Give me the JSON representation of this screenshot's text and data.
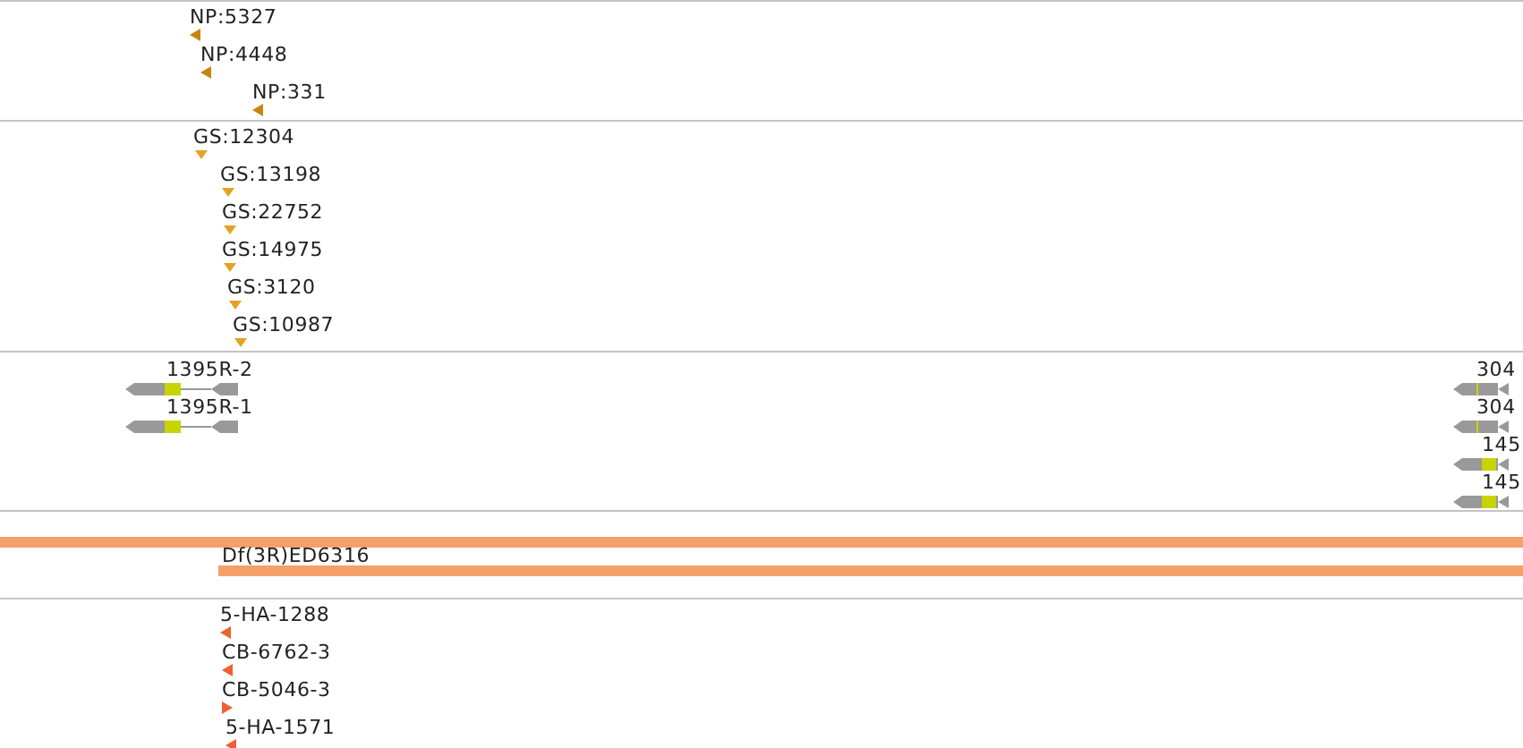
{
  "tracks": [
    {
      "kind": "marker",
      "features": [
        {
          "label": "NP:5327",
          "kind": "reverse"
        },
        {
          "label": "NP:4448",
          "kind": "reverse"
        },
        {
          "label": "NP:331",
          "kind": "reverse"
        }
      ]
    },
    {
      "kind": "marker",
      "features": [
        {
          "label": "GS:12304",
          "kind": "unstranded"
        },
        {
          "label": "GS:13198",
          "kind": "unstranded"
        },
        {
          "label": "GS:22752",
          "kind": "unstranded"
        },
        {
          "label": "GS:14975",
          "kind": "unstranded"
        },
        {
          "label": "GS:3120",
          "kind": "unstranded"
        },
        {
          "label": "GS:10987",
          "kind": "unstranded"
        }
      ]
    },
    {
      "kind": "gene",
      "features": [
        {
          "label": "1395R-2",
          "kind": "reverse"
        },
        {
          "label": "1395R-1",
          "kind": "reverse"
        },
        {
          "label": "304",
          "kind": "reverse"
        },
        {
          "label": "304",
          "kind": "reverse"
        },
        {
          "label": "145",
          "kind": "reverse"
        },
        {
          "label": "145",
          "kind": "reverse"
        }
      ]
    },
    {
      "kind": "deletion",
      "features": [
        {
          "label": "Df(3R)ED6316"
        }
      ]
    },
    {
      "kind": "insertion",
      "features": [
        {
          "label": "5-HA-1288",
          "kind": "reverse"
        },
        {
          "label": "CB-6762-3",
          "kind": "reverse"
        },
        {
          "label": "CB-5046-3",
          "kind": "forward"
        },
        {
          "label": "5-HA-1571",
          "kind": "reverse"
        }
      ]
    }
  ]
}
